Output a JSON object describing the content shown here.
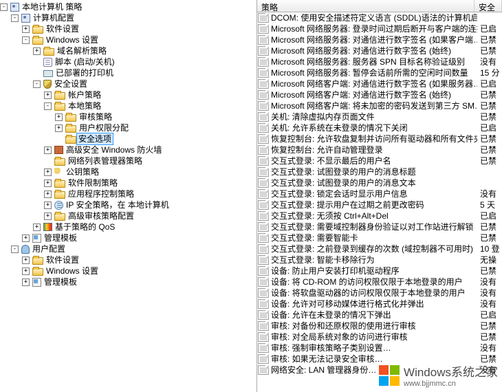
{
  "tree": [
    {
      "depth": 0,
      "toggle": "-",
      "icon": "policy",
      "label": "本地计算机 策略"
    },
    {
      "depth": 1,
      "toggle": "-",
      "icon": "policy",
      "label": "计算机配置"
    },
    {
      "depth": 2,
      "toggle": "+",
      "icon": "folder",
      "label": "软件设置"
    },
    {
      "depth": 2,
      "toggle": "-",
      "icon": "folder",
      "label": "Windows 设置"
    },
    {
      "depth": 3,
      "toggle": "+",
      "icon": "folder",
      "label": "域名解析策略"
    },
    {
      "depth": 3,
      "toggle": " ",
      "icon": "scroll",
      "label": "脚本 (启动/关机)"
    },
    {
      "depth": 3,
      "toggle": " ",
      "icon": "printer",
      "label": "已部署的打印机"
    },
    {
      "depth": 3,
      "toggle": "-",
      "icon": "shield",
      "label": "安全设置"
    },
    {
      "depth": 4,
      "toggle": "+",
      "icon": "folder",
      "label": "帐户策略"
    },
    {
      "depth": 4,
      "toggle": "-",
      "icon": "folder",
      "label": "本地策略"
    },
    {
      "depth": 5,
      "toggle": "+",
      "icon": "folder",
      "label": "审核策略"
    },
    {
      "depth": 5,
      "toggle": "+",
      "icon": "folder",
      "label": "用户权限分配"
    },
    {
      "depth": 5,
      "toggle": " ",
      "icon": "folder",
      "label": "安全选项",
      "selected": true
    },
    {
      "depth": 4,
      "toggle": "+",
      "icon": "wall",
      "label": "高级安全 Windows 防火墙"
    },
    {
      "depth": 4,
      "toggle": " ",
      "icon": "folder",
      "label": "网络列表管理器策略"
    },
    {
      "depth": 4,
      "toggle": "+",
      "icon": "key",
      "label": "公钥策略"
    },
    {
      "depth": 4,
      "toggle": "+",
      "icon": "folder",
      "label": "软件限制策略"
    },
    {
      "depth": 4,
      "toggle": "+",
      "icon": "folder",
      "label": "应用程序控制策略"
    },
    {
      "depth": 4,
      "toggle": "+",
      "icon": "ip",
      "label": "IP 安全策略，在 本地计算机"
    },
    {
      "depth": 4,
      "toggle": "+",
      "icon": "folder",
      "label": "高级审核策略配置"
    },
    {
      "depth": 3,
      "toggle": "+",
      "icon": "qos",
      "label": "基于策略的 QoS"
    },
    {
      "depth": 2,
      "toggle": "+",
      "icon": "tmpl",
      "label": "管理模板"
    },
    {
      "depth": 1,
      "toggle": "-",
      "icon": "user",
      "label": "用户配置"
    },
    {
      "depth": 2,
      "toggle": "+",
      "icon": "folder",
      "label": "软件设置"
    },
    {
      "depth": 2,
      "toggle": "+",
      "icon": "folder",
      "label": "Windows 设置"
    },
    {
      "depth": 2,
      "toggle": "+",
      "icon": "tmpl",
      "label": "管理模板"
    }
  ],
  "columns": {
    "policy": "策略",
    "setting": "安全"
  },
  "rows": [
    {
      "p": "DCOM: 使用安全描述符定义语言 (SDDL)语法的计算机启动限制",
      "s": ""
    },
    {
      "p": "Microsoft 网络服务器: 登录时间过期后断开与客户端的连接",
      "s": "已启"
    },
    {
      "p": "Microsoft 网络服务器: 对通信进行数字签名 (如果客户端…",
      "s": "已禁"
    },
    {
      "p": "Microsoft 网络服务器: 对通信进行数字签名 (始终)",
      "s": "已禁"
    },
    {
      "p": "Microsoft 网络服务器: 服务器 SPN 目标名称验证级别",
      "s": "没有"
    },
    {
      "p": "Microsoft 网络服务器: 暂停会话前所需的空闲时间数量",
      "s": "15 分"
    },
    {
      "p": "Microsoft 网络客户端: 对通信进行数字签名 (如果服务器…",
      "s": "已启"
    },
    {
      "p": "Microsoft 网络客户端: 对通信进行数字签名 (始终)",
      "s": "已禁"
    },
    {
      "p": "Microsoft 网络客户端: 将未加密的密码发送到第三方 SM…",
      "s": "已禁"
    },
    {
      "p": "关机: 清除虚拟内存页面文件",
      "s": "已禁"
    },
    {
      "p": "关机: 允许系统在未登录的情况下关闭",
      "s": "已启"
    },
    {
      "p": "恢复控制台: 允许软盘复制并访问所有驱动器和所有文件夹",
      "s": "已禁"
    },
    {
      "p": "恢复控制台: 允许自动管理登录",
      "s": "已禁"
    },
    {
      "p": "交互式登录: 不显示最后的用户名",
      "s": "已禁"
    },
    {
      "p": "交互式登录: 试图登录的用户的消息标题",
      "s": ""
    },
    {
      "p": "交互式登录: 试图登录的用户的消息文本",
      "s": ""
    },
    {
      "p": "交互式登录: 锁定会话时显示用户信息",
      "s": "没有"
    },
    {
      "p": "交互式登录: 提示用户在过期之前更改密码",
      "s": "5 天"
    },
    {
      "p": "交互式登录: 无须按 Ctrl+Alt+Del",
      "s": "已启"
    },
    {
      "p": "交互式登录: 需要域控制器身份验证以对工作站进行解锁",
      "s": "已禁"
    },
    {
      "p": "交互式登录: 需要智能卡",
      "s": "已禁"
    },
    {
      "p": "交互式登录: 之前登录到缓存的次数 (域控制器不可用时)",
      "s": "10 登"
    },
    {
      "p": "交互式登录: 智能卡移除行为",
      "s": "无操"
    },
    {
      "p": "设备: 防止用户安装打印机驱动程序",
      "s": "已禁"
    },
    {
      "p": "设备: 将 CD-ROM 的访问权限仅限于本地登录的用户",
      "s": "没有"
    },
    {
      "p": "设备: 将软盘驱动器的访问权限仅限于本地登录的用户",
      "s": "没有"
    },
    {
      "p": "设备: 允许对可移动媒体进行格式化并弹出",
      "s": "没有"
    },
    {
      "p": "设备: 允许在未登录的情况下弹出",
      "s": "已启"
    },
    {
      "p": "审核: 对备份和还原权限的使用进行审核",
      "s": "已禁"
    },
    {
      "p": "审核: 对全局系统对象的访问进行审核",
      "s": "已禁"
    },
    {
      "p": "审核: 强制审核策略子类别设置…",
      "s": "没有"
    },
    {
      "p": "审核: 如果无法记录安全审核…",
      "s": "已禁"
    },
    {
      "p": "网络安全: LAN 管理器身份…",
      "s": "没有"
    }
  ],
  "watermark": {
    "title": "Windows",
    "sub": "系统之家",
    "site": "www.bjjmmc.cn"
  }
}
